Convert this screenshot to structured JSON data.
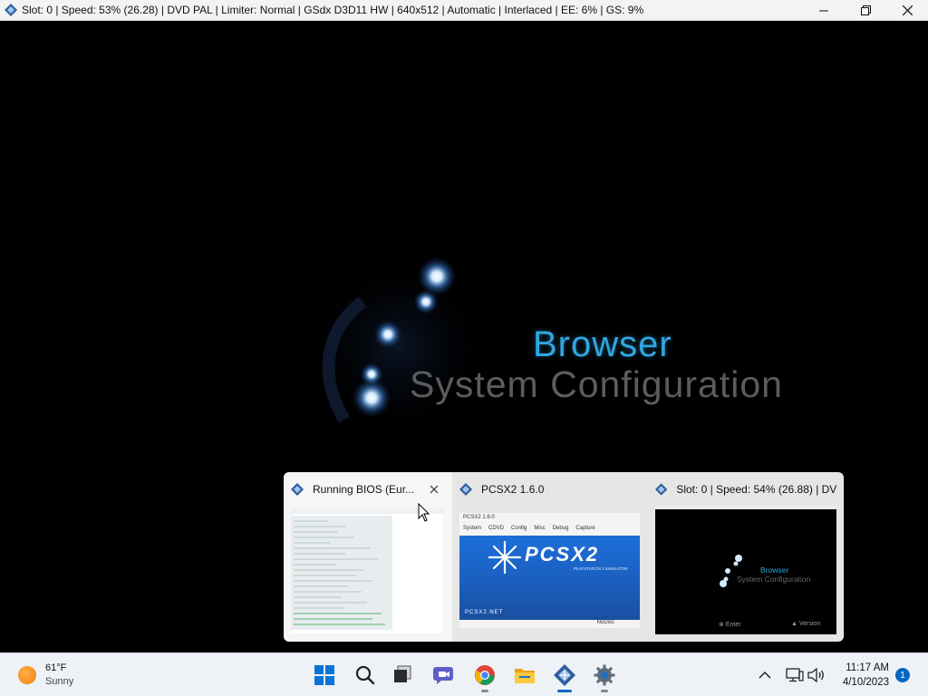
{
  "window": {
    "title": "Slot: 0 | Speed:  53% (26.28) | DVD PAL | Limiter: Normal | GSdx D3D11 HW | 640x512 | Automatic | Interlaced | EE:   6% | GS:   9%",
    "controls": [
      "minimize-icon",
      "maximize-icon",
      "close-icon"
    ]
  },
  "game": {
    "line1": "Browser",
    "line2": "System Configuration",
    "colors": {
      "browser": "#31a6e0",
      "sysconf": "#5c5c5c"
    }
  },
  "switcher": {
    "cards": [
      {
        "label": "Running BIOS (Eur...",
        "icon": "pcsx2-icon",
        "closable": true
      },
      {
        "label": "PCSX2  1.6.0",
        "icon": "pcsx2-icon",
        "closable": false
      },
      {
        "label": "Slot: 0 | Speed:  54% (26.88) | DV...",
        "icon": "pcsx2-icon",
        "closable": false
      }
    ],
    "pcsx2_preview": {
      "title": "PCSX2    1.6.0",
      "menu": [
        "System",
        "CDVD",
        "Config",
        "Misc",
        "Debug",
        "Capture"
      ],
      "logo": "PCSX2",
      "subtitle": "PLAYSTATION 2 EMULATOR",
      "url": "PCSX2.NET",
      "status": "NoDisc"
    },
    "game_preview": {
      "line1": "Browser",
      "line2": "System Configuration",
      "enter": "⊗ Enter",
      "version": "▲ Version"
    }
  },
  "taskbar": {
    "weather": {
      "temp": "61°F",
      "condition": "Sunny"
    },
    "apps": [
      "start-icon",
      "search-icon",
      "task-view-icon",
      "teams-chat-icon",
      "chrome-icon",
      "file-explorer-icon",
      "pcsx2-icon",
      "settings-icon"
    ],
    "tray": [
      "chevron-up-icon",
      "network-icon",
      "volume-icon"
    ],
    "clock": {
      "time": "11:17 AM",
      "date": "4/10/2023"
    },
    "notifications": "1"
  }
}
